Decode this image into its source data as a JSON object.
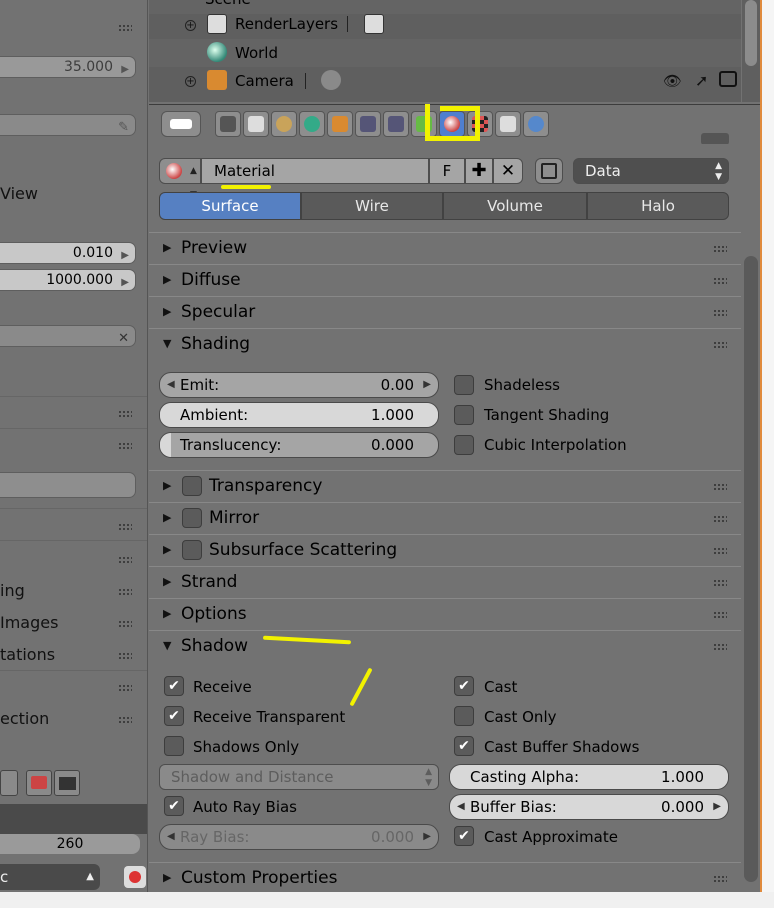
{
  "left_panel": {
    "field_value_1": "35.000",
    "text_view": "View",
    "clip_start": "0.010",
    "clip_end": "1000.000",
    "frame_value": "260",
    "partial_labels": [
      "ing",
      "Images",
      "tations",
      "ection"
    ],
    "bottom_select": "c"
  },
  "outliner": {
    "items": [
      {
        "label": "Scene"
      },
      {
        "label": "RenderLayers"
      },
      {
        "label": "World"
      },
      {
        "label": "Camera"
      }
    ]
  },
  "material": {
    "slot_name": "Material",
    "fake_user_label": "F",
    "link_select": "Data",
    "tabs": [
      "Surface",
      "Wire",
      "Volume",
      "Halo"
    ],
    "active_tab": "Surface"
  },
  "panels": {
    "preview": "Preview",
    "diffuse": "Diffuse",
    "specular": "Specular",
    "shading": "Shading",
    "transparency": "Transparency",
    "mirror": "Mirror",
    "sss": "Subsurface Scattering",
    "strand": "Strand",
    "options": "Options",
    "shadow": "Shadow",
    "custom_props": "Custom Properties"
  },
  "shading": {
    "emit_label": "Emit:",
    "emit_value": "0.00",
    "ambient_label": "Ambient:",
    "ambient_value": "1.000",
    "translucency_label": "Translucency:",
    "translucency_value": "0.000",
    "shadeless": "Shadeless",
    "tangent": "Tangent Shading",
    "cubic": "Cubic Interpolation"
  },
  "shadow": {
    "receive": "Receive",
    "receive_transparent": "Receive Transparent",
    "shadows_only": "Shadows Only",
    "shadow_mode": "Shadow and Distance",
    "auto_ray_bias": "Auto Ray Bias",
    "ray_bias_label": "Ray Bias:",
    "ray_bias_value": "0.000",
    "cast": "Cast",
    "cast_only": "Cast Only",
    "cast_buffer": "Cast Buffer Shadows",
    "casting_alpha_label": "Casting Alpha:",
    "casting_alpha_value": "1.000",
    "buffer_bias_label": "Buffer Bias:",
    "buffer_bias_value": "0.000",
    "cast_approx": "Cast Approximate"
  },
  "colors": {
    "accent": "#5680c2",
    "annotation": "#f2f200",
    "orange_border": "#e08a3c"
  }
}
